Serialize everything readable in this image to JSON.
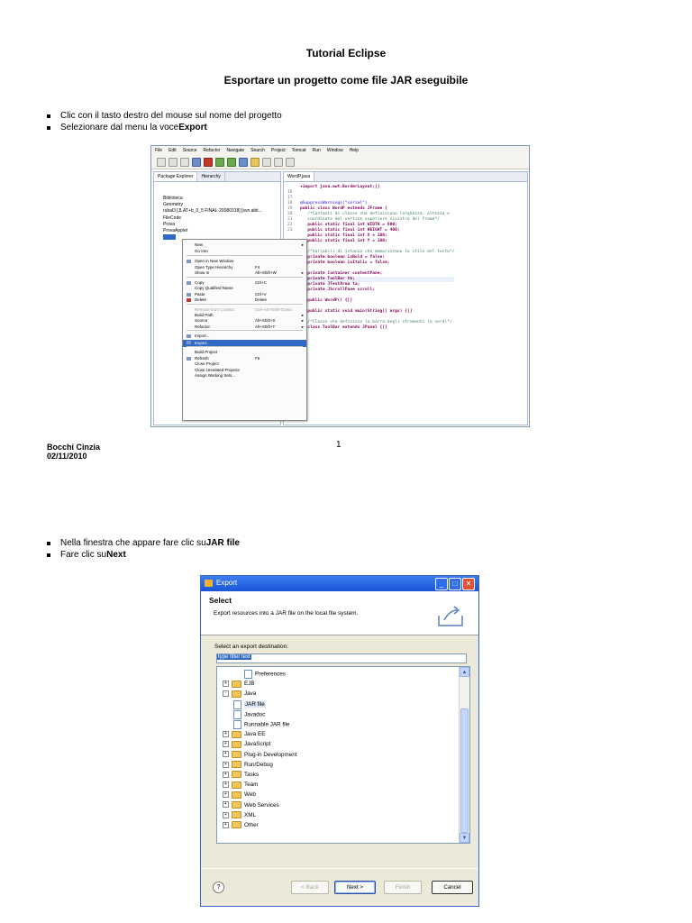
{
  "page": {
    "title": "Tutorial Eclipse",
    "subtitle": "Esportare un progetto come file JAR eseguibile",
    "footer_author": "Bocchi Cinzia",
    "footer_date": "02/11/2010",
    "page_number": "1"
  },
  "steps1": [
    {
      "text": "Clic con il tasto destro del mouse sul nome del progetto",
      "bold": ""
    },
    {
      "text": "Selezionare dal menu la voce ",
      "bold": "Export"
    }
  ],
  "steps2": [
    {
      "text": "Nella finestra che appare fare clic su ",
      "bold": "JAR file"
    },
    {
      "text": "Fare clic su ",
      "bold": "Next"
    }
  ],
  "eclipse": {
    "menu": [
      "File",
      "Edit",
      "Source",
      "Refactor",
      "Navigate",
      "Search",
      "Project",
      "Tomcat",
      "Run",
      "Window",
      "Help"
    ],
    "left_tabs": [
      "Package Explorer",
      "Hierarchy"
    ],
    "editor_tab": "WordP.java",
    "tree": [
      "Biblioteca",
      "Geometry",
      "rubal3 [JLAT+b_0_5 FINAL-20080318] [svn.abit...",
      "FileCode",
      "Prova",
      "ProvaApplet"
    ],
    "context_menu": [
      {
        "label": "New",
        "shortcut": "",
        "arrow": true,
        "disabled": false,
        "highlight": false
      },
      {
        "label": "Go Into",
        "shortcut": "",
        "arrow": false,
        "disabled": false,
        "highlight": false
      },
      {
        "label": "Open in New Window",
        "shortcut": "",
        "arrow": false,
        "disabled": false,
        "highlight": false
      },
      {
        "label": "Open Type Hierarchy",
        "shortcut": "F4",
        "arrow": false,
        "disabled": false,
        "highlight": false
      },
      {
        "label": "Show In",
        "shortcut": "Alt+Shift+W",
        "arrow": true,
        "disabled": false,
        "highlight": false
      },
      {
        "label": "Copy",
        "shortcut": "Ctrl+C",
        "arrow": false,
        "disabled": false,
        "highlight": false
      },
      {
        "label": "Copy Qualified Name",
        "shortcut": "",
        "arrow": false,
        "disabled": false,
        "highlight": false
      },
      {
        "label": "Paste",
        "shortcut": "Ctrl+V",
        "arrow": false,
        "disabled": false,
        "highlight": false
      },
      {
        "label": "Delete",
        "shortcut": "Delete",
        "arrow": false,
        "disabled": false,
        "highlight": false
      },
      {
        "label": "Remove from Context",
        "shortcut": "Ctrl+Alt+Shift+Down",
        "arrow": false,
        "disabled": true,
        "highlight": false
      },
      {
        "label": "Build Path",
        "shortcut": "",
        "arrow": true,
        "disabled": false,
        "highlight": false
      },
      {
        "label": "Source",
        "shortcut": "Alt+Shift+S",
        "arrow": true,
        "disabled": false,
        "highlight": false
      },
      {
        "label": "Refactor",
        "shortcut": "Alt+Shift+T",
        "arrow": true,
        "disabled": false,
        "highlight": false
      },
      {
        "label": "Import...",
        "shortcut": "",
        "arrow": false,
        "disabled": false,
        "highlight": false
      },
      {
        "label": "Export...",
        "shortcut": "",
        "arrow": false,
        "disabled": false,
        "highlight": true
      },
      {
        "label": "Build Project",
        "shortcut": "",
        "arrow": false,
        "disabled": false,
        "highlight": false
      },
      {
        "label": "Refresh",
        "shortcut": "F5",
        "arrow": false,
        "disabled": false,
        "highlight": false
      },
      {
        "label": "Close Project",
        "shortcut": "",
        "arrow": false,
        "disabled": false,
        "highlight": false
      },
      {
        "label": "Close Unrelated Projects",
        "shortcut": "",
        "arrow": false,
        "disabled": false,
        "highlight": false
      },
      {
        "label": "Assign Working Sets...",
        "shortcut": "",
        "arrow": false,
        "disabled": false,
        "highlight": false
      }
    ],
    "code": [
      {
        "n": "",
        "t": "+import java.awt.BorderLayout;[]",
        "c": "kw"
      },
      {
        "n": "16",
        "t": "",
        "c": ""
      },
      {
        "n": "17",
        "t": "",
        "c": ""
      },
      {
        "n": "18",
        "t": "@SuppressWarnings(\"serial\")",
        "c": "st"
      },
      {
        "n": "19",
        "t": "public class WordP extends JFrame {",
        "c": "kw"
      },
      {
        "n": "20",
        "t": "   /*Costanti di classe che definiscono larghezza, altezza e",
        "c": "cm"
      },
      {
        "n": "21",
        "t": "   coordinate del vertice superiore sinistro del frame*/",
        "c": "cm"
      },
      {
        "n": "22",
        "t": "   public static final int WIDTH = 600;",
        "c": "kw"
      },
      {
        "n": "23",
        "t": "   public static final int HEIGHT = 400;",
        "c": "kw"
      },
      {
        "n": "",
        "t": "   public static final int X = 100;",
        "c": "kw"
      },
      {
        "n": "",
        "t": "   public static final int Y = 100;",
        "c": "kw"
      },
      {
        "n": "",
        "t": "",
        "c": ""
      },
      {
        "n": "",
        "t": "   /*Variabili di istanza che memorizzano lo stile del testo*/",
        "c": "cm"
      },
      {
        "n": "",
        "t": "   private boolean isBold = false;",
        "c": "kw"
      },
      {
        "n": "",
        "t": "   private boolean isItalic = false;",
        "c": "kw"
      },
      {
        "n": "",
        "t": "",
        "c": ""
      },
      {
        "n": "",
        "t": "   private Container contentPane;",
        "c": "kw"
      },
      {
        "n": "",
        "t": "   private ToolBar tb;",
        "c": "kwh"
      },
      {
        "n": "",
        "t": "   private JTextArea ta;",
        "c": "kw"
      },
      {
        "n": "",
        "t": "   private JScrollPane scroll;",
        "c": "kw"
      },
      {
        "n": "",
        "t": "",
        "c": ""
      },
      {
        "n": "",
        "t": "   public WordP() {[]",
        "c": "kw"
      },
      {
        "n": "",
        "t": "",
        "c": ""
      },
      {
        "n": "",
        "t": "   public static void main(String[] args) {[]",
        "c": "kw"
      },
      {
        "n": "",
        "t": "",
        "c": ""
      },
      {
        "n": "",
        "t": "   /*Classe che definisce la barra degli strumenti (a sord)*/",
        "c": "cm"
      },
      {
        "n": "",
        "t": "   class ToolBar extends JPanel {[]",
        "c": "kw"
      }
    ]
  },
  "dialog": {
    "title": "Export",
    "header": "Select",
    "description": "Export resources into a JAR file on the local file system.",
    "dest_label": "Select an export destination:",
    "filter_text": "type filter text",
    "tree": [
      {
        "label": "Preferences",
        "indent": 2,
        "kind": "file",
        "exp": ""
      },
      {
        "label": "EJB",
        "indent": 0,
        "kind": "folder",
        "exp": "+"
      },
      {
        "label": "Java",
        "indent": 0,
        "kind": "folder",
        "exp": "-"
      },
      {
        "label": "JAR file",
        "indent": 1,
        "kind": "file",
        "exp": "",
        "hl": true
      },
      {
        "label": "Javadoc",
        "indent": 1,
        "kind": "file",
        "exp": ""
      },
      {
        "label": "Runnable JAR file",
        "indent": 1,
        "kind": "file",
        "exp": ""
      },
      {
        "label": "Java EE",
        "indent": 0,
        "kind": "folder",
        "exp": "+"
      },
      {
        "label": "JavaScript",
        "indent": 0,
        "kind": "folder",
        "exp": "+"
      },
      {
        "label": "Plug-in Development",
        "indent": 0,
        "kind": "folder",
        "exp": "+"
      },
      {
        "label": "Run/Debug",
        "indent": 0,
        "kind": "folder",
        "exp": "+"
      },
      {
        "label": "Tasks",
        "indent": 0,
        "kind": "folder",
        "exp": "+"
      },
      {
        "label": "Team",
        "indent": 0,
        "kind": "folder",
        "exp": "+"
      },
      {
        "label": "Web",
        "indent": 0,
        "kind": "folder",
        "exp": "+"
      },
      {
        "label": "Web Services",
        "indent": 0,
        "kind": "folder",
        "exp": "+"
      },
      {
        "label": "XML",
        "indent": 0,
        "kind": "folder",
        "exp": "+"
      },
      {
        "label": "Other",
        "indent": 0,
        "kind": "folder",
        "exp": "+"
      }
    ],
    "buttons": {
      "back": "< Back",
      "next": "Next >",
      "finish": "Finish",
      "cancel": "Cancel",
      "help": "?"
    }
  }
}
